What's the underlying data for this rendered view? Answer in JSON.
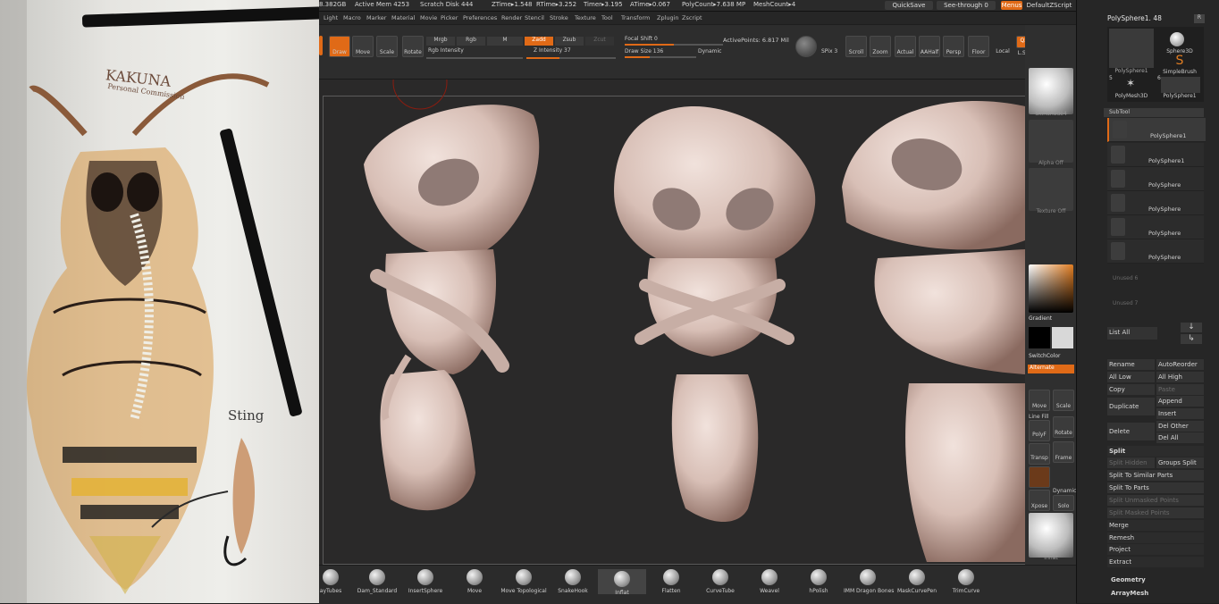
{
  "status": {
    "mem": "8.382GB",
    "active_mem": "Active Mem 4253",
    "scratch": "Scratch Disk 444",
    "ztime": "ZTime▸1.548",
    "rtime": "RTime▸3.252",
    "timer": "Timer▸3.195",
    "atime": "ATime▸0.067",
    "polycount": "PolyCount▸7.638 MP",
    "meshcount": "MeshCount▸4",
    "quicksave": "QuickSave",
    "seethrough": "See-through  0",
    "menus": "Menus",
    "script": "DefaultZScript"
  },
  "menu": [
    "Light",
    "Macro",
    "Marker",
    "Material",
    "Movie",
    "Picker",
    "Preferences",
    "Render",
    "Stencil",
    "Stroke",
    "Texture",
    "Tool",
    "Transform",
    "Zplugin",
    "Zscript"
  ],
  "toolbar": {
    "draw": "Draw",
    "move": "Move",
    "scale": "Scale",
    "rotate": "Rotate",
    "mrgb": "Mrgb",
    "rgb": "Rgb",
    "m": "M",
    "zadd": "Zadd",
    "zsub": "Zsub",
    "zcut": "Zcut",
    "rgb_intensity": "Rgb Intensity",
    "z_intensity": "Z Intensity 37",
    "focal_shift": "Focal Shift 0",
    "draw_size": "Draw Size 136",
    "dynamic": "Dynamic",
    "active_points": "ActivePoints: 6.817 Mil",
    "spix": "SPix 3",
    "scroll": "Scroll",
    "zoom": "Zoom",
    "actual": "Actual",
    "aahalf": "AAHalf",
    "persp": "Persp",
    "floor": "Floor",
    "local": "Local",
    "lsym": "L.Sym",
    "qxyz": "Qxyz"
  },
  "sketch": {
    "title": "KAKUNA",
    "subtitle": "Personal Commission",
    "note": "Sting"
  },
  "rshelf": {
    "skinshade": "SkinShade4",
    "alpha": "Alpha Off",
    "texture": "Texture Off",
    "gradient": "Gradient",
    "switchcolor": "SwitchColor",
    "alternate": "Alternate",
    "move": "Move",
    "scale": "Scale",
    "polyf": "PolyF",
    "linefill": "Line Fill",
    "rotate": "Rotate",
    "transp": "Transp",
    "frame": "Frame",
    "xpose": "Xpose",
    "solo": "Solo",
    "dynamic": "Dynamic",
    "inflat": "Inflat",
    "colors": {
      "primary": "#000000",
      "secondary": "#d8d8d8",
      "accent": "#e06a17"
    }
  },
  "tool": {
    "current": "PolySphere1. 48",
    "r": "R",
    "thumbs": [
      "PolySphere1",
      "Sphere3D",
      "SimpleBrush",
      "PolyMesh3D",
      "PolySphere1"
    ],
    "thumb_nums": [
      "5",
      "6"
    ],
    "subtool_header": "SubTool",
    "subtools": [
      "PolySphere1",
      "PolySphere1",
      "PolySphere",
      "PolySphere",
      "PolySphere",
      "PolySphere"
    ],
    "empty1": "Unused 6",
    "empty2": "Unused 7",
    "list_all": "List  All",
    "rename": "Rename",
    "autoreorder": "AutoReorder",
    "all_low": "All Low",
    "all_high": "All High",
    "copy": "Copy",
    "paste": "Paste",
    "duplicate": "Duplicate",
    "append": "Append",
    "insert": "Insert",
    "delete": "Delete",
    "del_other": "Del Other",
    "del_all": "Del All",
    "split": "Split",
    "split_hidden": "Split Hidden",
    "groups_split": "Groups Split",
    "split_similar": "Split To Similar Parts",
    "split_parts": "Split To Parts",
    "split_unmasked": "Split Unmasked Points",
    "split_masked": "Split Masked Points",
    "merge": "Merge",
    "remesh": "Remesh",
    "project": "Project",
    "extract": "Extract",
    "geometry": "Geometry",
    "arraymesh": "ArrayMesh"
  },
  "brushes": [
    "ayTubes",
    "Dam_Standard",
    "InsertSphere",
    "Move",
    "Move Topological",
    "SnakeHook",
    "Inflat",
    "Flatten",
    "CurveTube",
    "Weavel",
    "hPolish",
    "IMM Dragon Bones",
    "MaskCurvePen",
    "TrimCurve"
  ]
}
